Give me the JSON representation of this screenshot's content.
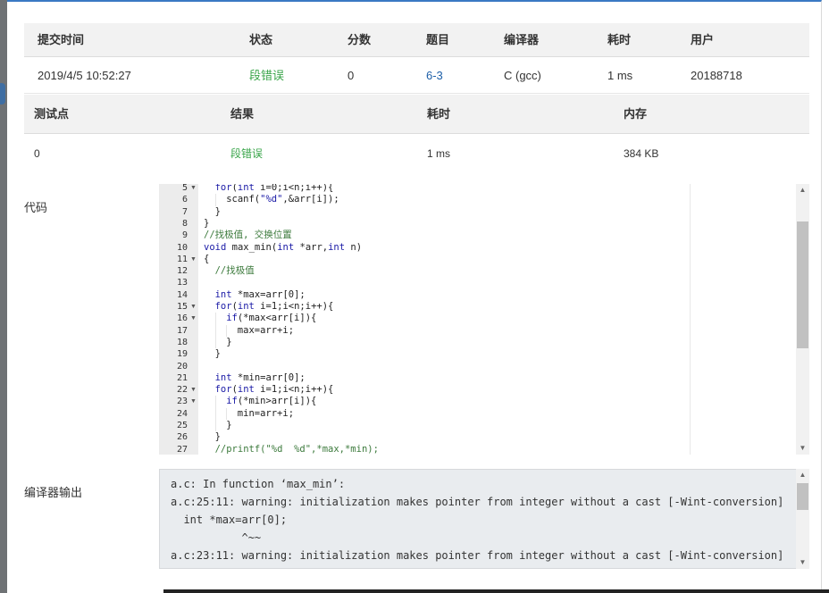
{
  "submission": {
    "headers": [
      "提交时间",
      "状态",
      "分数",
      "题目",
      "编译器",
      "耗时",
      "用户"
    ],
    "row": {
      "time": "2019/4/5 10:52:27",
      "status": "段错误",
      "score": "0",
      "problem": "6-3",
      "compiler": "C (gcc)",
      "elapsed": "1 ms",
      "user": "20188718"
    }
  },
  "tests": {
    "headers": [
      "测试点",
      "结果",
      "耗时",
      "内存"
    ],
    "rows": [
      {
        "id": "0",
        "result": "段错误",
        "elapsed": "1 ms",
        "memory": "384 KB"
      }
    ]
  },
  "labels": {
    "code": "代码",
    "compiler_output": "编译器输出"
  },
  "code": {
    "lines": [
      {
        "n": "5",
        "fold": true,
        "indent": 1,
        "parts": [
          [
            "kw",
            "for"
          ],
          [
            "txt",
            "("
          ],
          [
            "kw",
            "int"
          ],
          [
            "txt",
            " i=0;i<n;i++){"
          ]
        ]
      },
      {
        "n": "6",
        "fold": false,
        "indent": 2,
        "parts": [
          [
            "txt",
            "scanf("
          ],
          [
            "str",
            "\"%d\""
          ],
          [
            "txt",
            ",&arr[i]);"
          ]
        ]
      },
      {
        "n": "7",
        "fold": false,
        "indent": 1,
        "parts": [
          [
            "txt",
            "}"
          ]
        ]
      },
      {
        "n": "8",
        "fold": false,
        "indent": 0,
        "parts": [
          [
            "txt",
            "}"
          ]
        ]
      },
      {
        "n": "9",
        "fold": false,
        "indent": 0,
        "parts": [
          [
            "cm",
            "//找极值, 交换位置"
          ]
        ]
      },
      {
        "n": "10",
        "fold": false,
        "indent": 0,
        "parts": [
          [
            "kw",
            "void"
          ],
          [
            "txt",
            " max_min("
          ],
          [
            "kw",
            "int"
          ],
          [
            "txt",
            " *arr,"
          ],
          [
            "kw",
            "int"
          ],
          [
            "txt",
            " n)"
          ]
        ]
      },
      {
        "n": "11",
        "fold": true,
        "indent": 0,
        "parts": [
          [
            "txt",
            "{"
          ]
        ]
      },
      {
        "n": "12",
        "fold": false,
        "indent": 1,
        "parts": [
          [
            "cm",
            "//找极值"
          ]
        ]
      },
      {
        "n": "13",
        "fold": false,
        "indent": 0,
        "parts": []
      },
      {
        "n": "14",
        "fold": false,
        "indent": 1,
        "parts": [
          [
            "kw",
            "int"
          ],
          [
            "txt",
            " *max=arr[0];"
          ]
        ]
      },
      {
        "n": "15",
        "fold": true,
        "indent": 1,
        "parts": [
          [
            "kw",
            "for"
          ],
          [
            "txt",
            "("
          ],
          [
            "kw",
            "int"
          ],
          [
            "txt",
            " i=1;i<n;i++){"
          ]
        ]
      },
      {
        "n": "16",
        "fold": true,
        "indent": 2,
        "parts": [
          [
            "kw",
            "if"
          ],
          [
            "txt",
            "(*max<arr[i]){"
          ]
        ]
      },
      {
        "n": "17",
        "fold": false,
        "indent": 3,
        "parts": [
          [
            "txt",
            "max=arr+i;"
          ]
        ]
      },
      {
        "n": "18",
        "fold": false,
        "indent": 2,
        "parts": [
          [
            "txt",
            "}"
          ]
        ]
      },
      {
        "n": "19",
        "fold": false,
        "indent": 1,
        "parts": [
          [
            "txt",
            "}"
          ]
        ]
      },
      {
        "n": "20",
        "fold": false,
        "indent": 0,
        "parts": []
      },
      {
        "n": "21",
        "fold": false,
        "indent": 1,
        "parts": [
          [
            "kw",
            "int"
          ],
          [
            "txt",
            " *min=arr[0];"
          ]
        ]
      },
      {
        "n": "22",
        "fold": true,
        "indent": 1,
        "parts": [
          [
            "kw",
            "for"
          ],
          [
            "txt",
            "("
          ],
          [
            "kw",
            "int"
          ],
          [
            "txt",
            " i=1;i<n;i++){"
          ]
        ]
      },
      {
        "n": "23",
        "fold": true,
        "indent": 2,
        "parts": [
          [
            "kw",
            "if"
          ],
          [
            "txt",
            "(*min>arr[i]){"
          ]
        ]
      },
      {
        "n": "24",
        "fold": false,
        "indent": 3,
        "parts": [
          [
            "txt",
            "min=arr+i;"
          ]
        ]
      },
      {
        "n": "25",
        "fold": false,
        "indent": 2,
        "parts": [
          [
            "txt",
            "}"
          ]
        ]
      },
      {
        "n": "26",
        "fold": false,
        "indent": 1,
        "parts": [
          [
            "txt",
            "}"
          ]
        ]
      },
      {
        "n": "27",
        "fold": false,
        "indent": 1,
        "parts": [
          [
            "cm",
            "//printf(\"%d  %d\",*max,*min);"
          ]
        ]
      }
    ]
  },
  "compiler_output": {
    "text": "a.c: In function ‘max_min’:\na.c:25:11: warning: initialization makes pointer from integer without a cast [-Wint-conversion]\n  int *max=arr[0];\n           ^~~\na.c:23:11: warning: initialization makes pointer from integer without a cast [-Wint-conversion]"
  },
  "colors": {
    "accent": "#3a79c3",
    "status_error": "#3aa54a",
    "link": "#1d5fa8"
  },
  "icons": {
    "scroll_up": "chevron-up-icon",
    "scroll_down": "chevron-down-icon",
    "fold": "fold-arrow-icon"
  }
}
